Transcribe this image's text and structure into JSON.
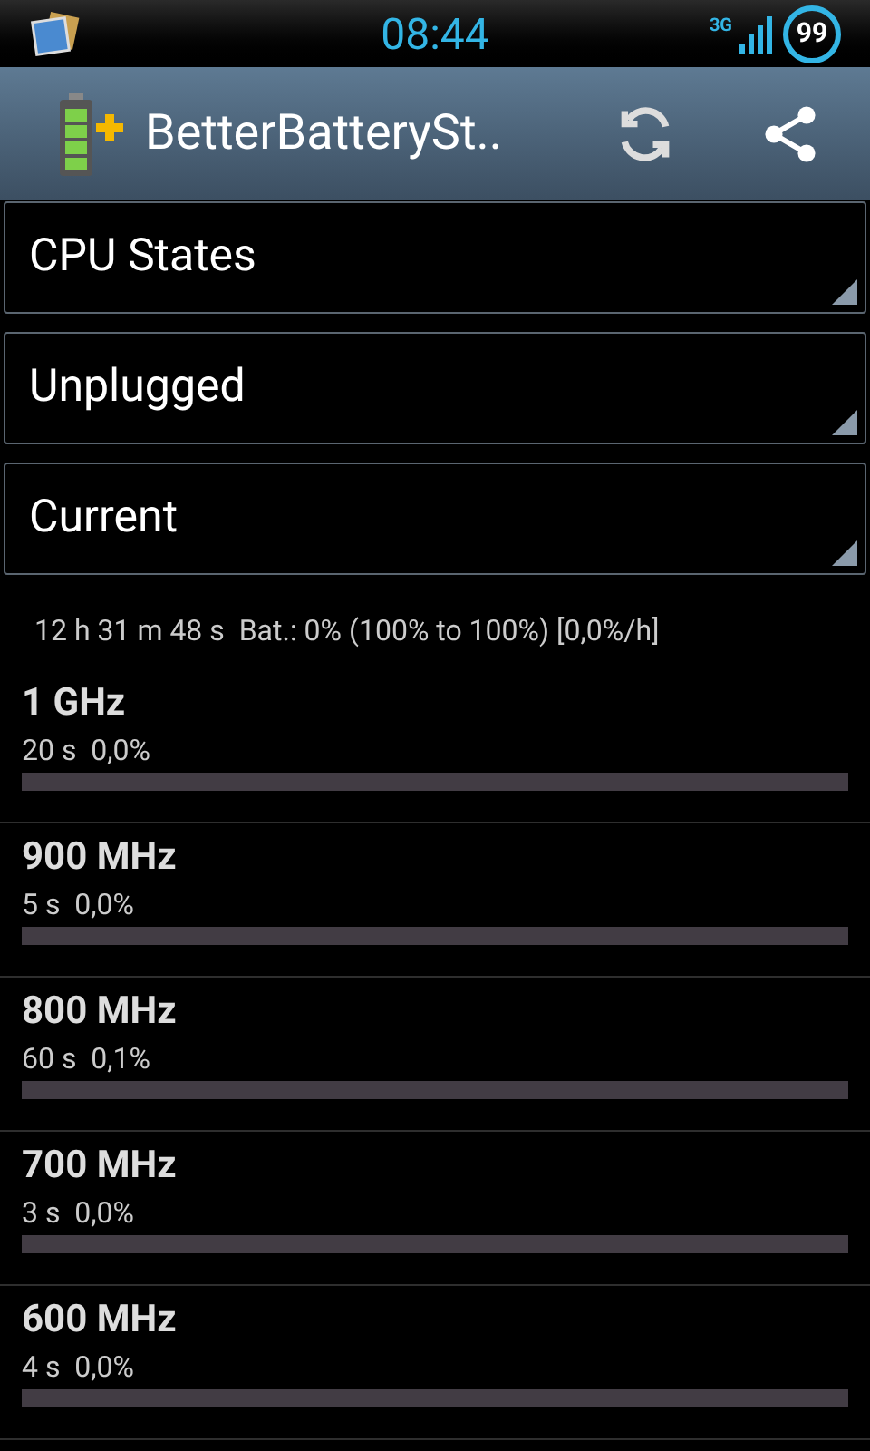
{
  "status_bar": {
    "time": "08:44",
    "network": "3G",
    "battery": "99"
  },
  "action_bar": {
    "title": "BetterBatterySt.."
  },
  "spinners": [
    {
      "value": "CPU States"
    },
    {
      "value": "Unplugged"
    },
    {
      "value": "Current"
    }
  ],
  "summary": "12 h 31 m 48 s  Bat.: 0% (100% to 100%) [0,0%/h]",
  "states": [
    {
      "name": "1 GHz",
      "detail": "20 s  0,0%"
    },
    {
      "name": "900 MHz",
      "detail": "5 s  0,0%"
    },
    {
      "name": "800 MHz",
      "detail": "60 s  0,1%"
    },
    {
      "name": "700 MHz",
      "detail": "3 s  0,0%"
    },
    {
      "name": "600 MHz",
      "detail": "4 s  0,0%"
    }
  ]
}
